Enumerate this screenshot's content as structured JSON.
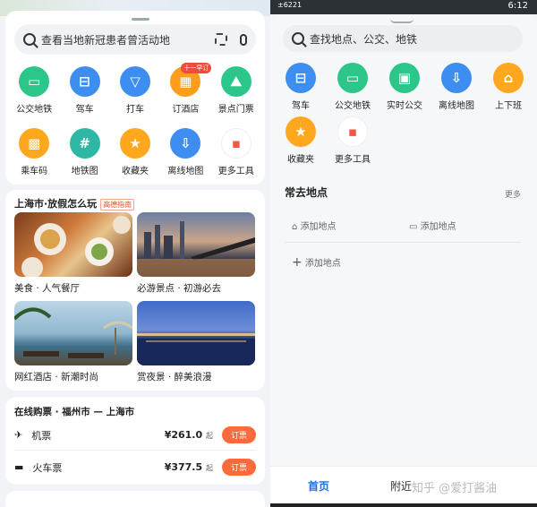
{
  "left": {
    "search": {
      "placeholder": "查看当地新冠患者曾活动地",
      "icons": [
        "search-icon",
        "scan-icon",
        "mic-icon"
      ]
    },
    "tools_row1": [
      {
        "label": "公交地铁",
        "color": "#2cc68b",
        "glyph": "▭"
      },
      {
        "label": "驾车",
        "color": "#3d8ef0",
        "glyph": "⊟"
      },
      {
        "label": "打车",
        "color": "#3d8ef0",
        "glyph": "▽"
      },
      {
        "label": "订酒店",
        "color": "#ff9d1f",
        "glyph": "▦",
        "badge": "十一早订"
      },
      {
        "label": "景点门票",
        "color": "#2cc68b",
        "glyph": "⛰"
      }
    ],
    "tools_row2": [
      {
        "label": "乘车码",
        "color": "#ffa81f",
        "glyph": "▩"
      },
      {
        "label": "地铁图",
        "color": "#2cb8a5",
        "glyph": "#"
      },
      {
        "label": "收藏夹",
        "color": "#ffa81f",
        "glyph": "★"
      },
      {
        "label": "离线地图",
        "color": "#3d8ef0",
        "glyph": "⇩"
      },
      {
        "label": "更多工具",
        "color": "#ffffff",
        "glyph": "▪"
      }
    ],
    "travel": {
      "title": "上海市·放假怎么玩",
      "tag": "高德指南",
      "items": [
        {
          "caption": "美食 · 人气餐厅"
        },
        {
          "caption": "必游景点 · 初游必去"
        },
        {
          "caption": "网红酒店 · 新潮时尚"
        },
        {
          "caption": "赏夜景 · 醉美浪漫"
        }
      ]
    },
    "tickets": {
      "title": "在线购票 · 福州市 — 上海市",
      "rows": [
        {
          "name": "机票",
          "price": "¥261.0",
          "suffix": "起",
          "button": "订票"
        },
        {
          "name": "火车票",
          "price": "¥377.5",
          "suffix": "起",
          "button": "订票"
        }
      ]
    }
  },
  "right": {
    "status": {
      "time": "6:12",
      "left": "±6221"
    },
    "search": {
      "placeholder": "查找地点、公交、地铁"
    },
    "tools_row1": [
      {
        "label": "驾车",
        "color": "#3d8ef0",
        "glyph": "⊟"
      },
      {
        "label": "公交地铁",
        "color": "#2cc68b",
        "glyph": "▭"
      },
      {
        "label": "实时公交",
        "color": "#2cc68b",
        "glyph": "▣"
      },
      {
        "label": "离线地图",
        "color": "#3d8ef0",
        "glyph": "⇩"
      },
      {
        "label": "上下班",
        "color": "#ffa81f",
        "glyph": "⌂"
      }
    ],
    "tools_row2": [
      {
        "label": "收藏夹",
        "color": "#ffa81f",
        "glyph": "★"
      },
      {
        "label": "更多工具",
        "color": "#ffffff",
        "glyph": "▪"
      }
    ],
    "places": {
      "title": "常去地点",
      "more": "更多",
      "home_add": "添加地点",
      "work_add": "添加地点",
      "add": "添加地点"
    },
    "nav": {
      "home": "首页",
      "nearby": "附近",
      "watermark": "知乎 @爱打酱油"
    }
  }
}
